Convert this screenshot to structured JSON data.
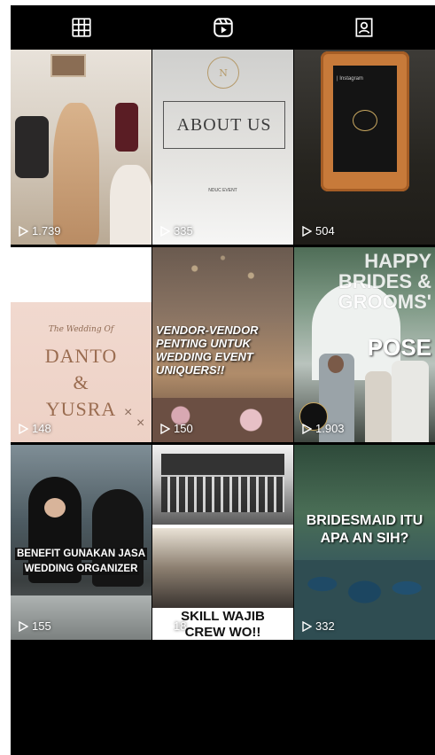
{
  "tabs": [
    {
      "icon": "grid-icon",
      "label": "Posts"
    },
    {
      "icon": "reels-icon",
      "label": "Reels"
    },
    {
      "icon": "tagged-icon",
      "label": "Tagged"
    }
  ],
  "reels": [
    {
      "views": "1.739"
    },
    {
      "views": "335",
      "overlay": {
        "title": "ABOUT US",
        "small": "NDUC EVENT"
      }
    },
    {
      "views": "504",
      "overlay": {
        "label": "| Instagram"
      }
    },
    {
      "views": "148",
      "overlay": {
        "script": "The Wedding Of",
        "line1": "DANTO",
        "line2": "&",
        "line3": "YUSRA"
      }
    },
    {
      "views": "150",
      "overlay": {
        "headline": "VENDOR-VENDOR PENTING UNTUK WEDDING EVENT UNIQUERS!!"
      }
    },
    {
      "views": "1.903",
      "overlay": {
        "line1": "HAPPY",
        "line2": "BRIDES &",
        "line3": "GROOMS'",
        "line4": "POSE"
      }
    },
    {
      "views": "155",
      "overlay": {
        "line1": "BENEFIT GUNAKAN JASA",
        "line2": "WEDDING ORGANIZER"
      }
    },
    {
      "views": "18",
      "overlay": {
        "line1": "SKILL WAJIB",
        "line2": "CREW WO!!"
      }
    },
    {
      "views": "332",
      "overlay": {
        "line1": "BRIDESMAID ITU",
        "line2": "APA AN SIH?"
      }
    }
  ]
}
